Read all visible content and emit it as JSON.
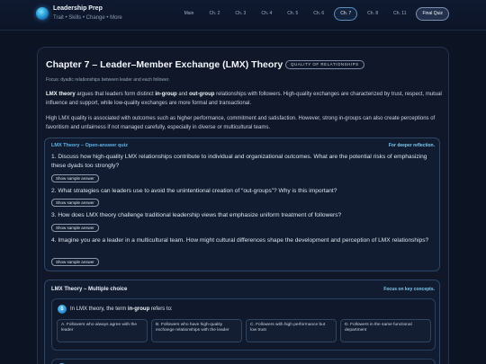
{
  "header": {
    "brand_title": "Leadership Prep",
    "brand_subtitle": "Trait • Skills • Change • More",
    "nav": [
      "Main",
      "Ch. 2",
      "Ch. 3",
      "Ch. 4",
      "Ch. 5",
      "Ch. 6",
      "Ch. 7",
      "Ch. 8",
      "Ch. 11",
      "Final Quiz"
    ],
    "active_nav": "Ch. 7"
  },
  "chapter": {
    "title": "Chapter 7 – Leader–Member Exchange (LMX) Theory",
    "badge": "QUALITY OF RELATIONSHIPS",
    "focus": "Focus: dyadic relationships between leader and each follower.",
    "p1_a": "LMX theory",
    "p1_b": " argues that leaders form distinct ",
    "p1_c": "in-group",
    "p1_d": " and ",
    "p1_e": "out-group",
    "p1_f": " relationships with followers. High-quality exchanges are characterized by trust, respect, mutual influence and support, while low-quality exchanges are more formal and transactional.",
    "p2": "High LMX quality is associated with outcomes such as higher performance, commitment and satisfaction. However, strong in-groups can also create perceptions of favoritism and unfairness if not managed carefully, especially in diverse or multicultural teams."
  },
  "open_quiz": {
    "title": "LMX Theory – Open-answer quiz",
    "tag": "For deeper reflection.",
    "show_label": "Show sample answer",
    "questions": [
      "1. Discuss how high-quality LMX relationships contribute to individual and organizational outcomes. What are the potential risks of emphasizing these dyads too strongly?",
      "2. What strategies can leaders use to avoid the unintentional creation of “out-groups”? Why is this important?",
      "3. How does LMX theory challenge traditional leadership views that emphasize uniform treatment of followers?",
      "4. Imagine you are a leader in a multicultural team. How might cultural differences shape the development and perception of LMX relationships?"
    ]
  },
  "mc_quiz": {
    "title": "LMX Theory – Multiple choice",
    "tag": "Focus on key concepts.",
    "q1_number": "1",
    "q1_a": "In LMX theory, the term ",
    "q1_b": "in-group",
    "q1_c": " refers to:",
    "options": [
      "A. Followers who always agree with the leader",
      "B. Followers who have high-quality exchange relationships with the leader",
      "C. Followers with high performance but low trust",
      "D. Followers in the same functional department"
    ]
  }
}
